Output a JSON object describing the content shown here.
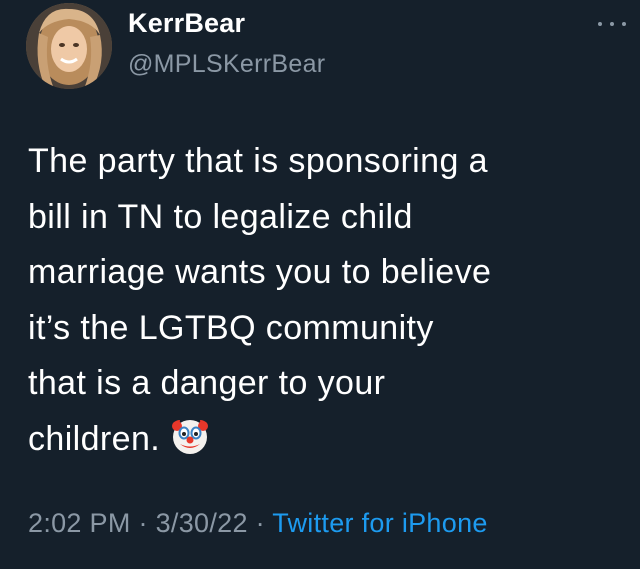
{
  "author": {
    "display_name": "KerrBear",
    "handle": "@MPLSKerrBear"
  },
  "more_menu_icon": "ellipsis-icon",
  "tweet": {
    "text": "The party that is sponsoring a\nbill in TN to legalize child\nmarriage wants you to believe\nit’s the LGTBQ community\nthat is a danger to your\nchildren.",
    "emoji": "clown-face-icon"
  },
  "meta": {
    "time": "2:02 PM",
    "separator": "·",
    "date": "3/30/22",
    "source": "Twitter for iPhone"
  },
  "colors": {
    "background": "#15202b",
    "text": "#ffffff",
    "secondary": "#8b98a5",
    "link": "#1d9bf0"
  }
}
